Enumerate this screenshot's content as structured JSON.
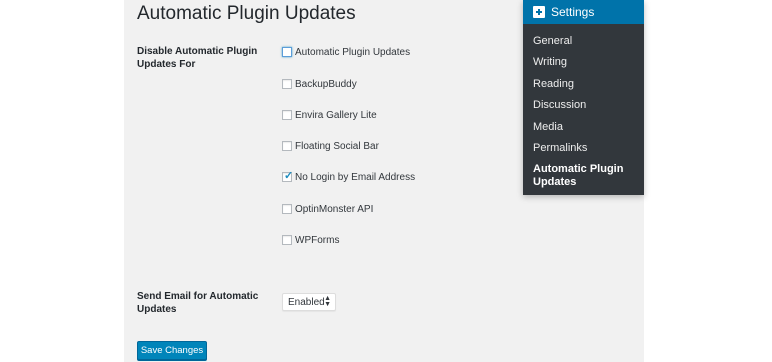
{
  "page": {
    "title": "Automatic Plugin Updates",
    "disable_label": "Disable Automatic Plugin Updates For",
    "plugins": [
      {
        "label": "Automatic Plugin Updates",
        "checked": false
      },
      {
        "label": "BackupBuddy",
        "checked": false
      },
      {
        "label": "Envira Gallery Lite",
        "checked": false
      },
      {
        "label": "Floating Social Bar",
        "checked": false
      },
      {
        "label": "No Login by Email Address",
        "checked": true
      },
      {
        "label": "OptinMonster API",
        "checked": false
      },
      {
        "label": "WPForms",
        "checked": false
      }
    ],
    "email_label": "Send Email for Automatic Updates",
    "email_select": {
      "value": "Enabled"
    },
    "save_label": "Save Changes"
  },
  "settings_menu": {
    "header": "Settings",
    "header_icon": "settings-icon",
    "items": [
      {
        "label": "General"
      },
      {
        "label": "Writing"
      },
      {
        "label": "Reading"
      },
      {
        "label": "Discussion"
      },
      {
        "label": "Media"
      },
      {
        "label": "Permalinks"
      },
      {
        "label": "Automatic Plugin Updates",
        "current": true
      }
    ]
  },
  "colors": {
    "accent": "#0073aa",
    "button": "#0085ba",
    "menu_bg": "#32373c",
    "panel_bg": "#f1f1f1",
    "check": "#1e8cbe"
  }
}
